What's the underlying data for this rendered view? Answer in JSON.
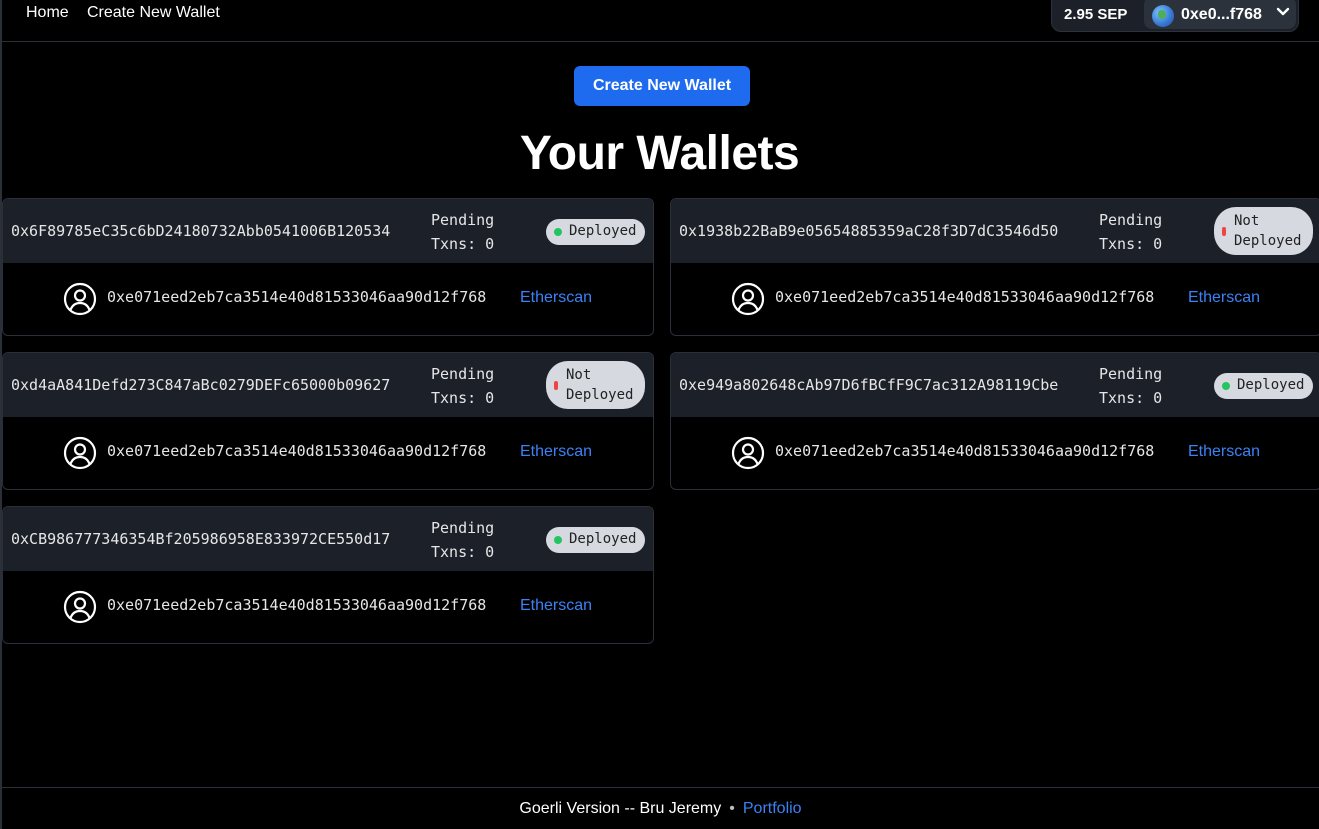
{
  "nav": {
    "home": "Home",
    "create": "Create New Wallet"
  },
  "account": {
    "balance": "2.95 SEP",
    "address_short": "0xe0...f768"
  },
  "main": {
    "create_button": "Create New Wallet",
    "title": "Your Wallets"
  },
  "wallets": [
    {
      "address": "0x6F89785eC35c6bD24180732Abb0541006B120534",
      "pending_label": "Pending",
      "txns": "Txns: 0",
      "status": "Deployed",
      "owner": "0xe071eed2eb7ca3514e40d81533046aa90d12f768",
      "link": "Etherscan"
    },
    {
      "address": "0x1938b22BaB9e05654885359aC28f3D7dC3546d50",
      "pending_label": "Pending",
      "txns": "Txns: 0",
      "status_line1": "Not",
      "status_line2": "Deployed",
      "owner": "0xe071eed2eb7ca3514e40d81533046aa90d12f768",
      "link": "Etherscan"
    },
    {
      "address": "0xd4aA841Defd273C847aBc0279DEFc65000b09627",
      "pending_label": "Pending",
      "txns": "Txns: 0",
      "status_line1": "Not",
      "status_line2": "Deployed",
      "owner": "0xe071eed2eb7ca3514e40d81533046aa90d12f768",
      "link": "Etherscan"
    },
    {
      "address": "0xe949a802648cAb97D6fBCfF9C7ac312A98119Cbe",
      "pending_label": "Pending",
      "txns": "Txns: 0",
      "status": "Deployed",
      "owner": "0xe071eed2eb7ca3514e40d81533046aa90d12f768",
      "link": "Etherscan"
    },
    {
      "address": "0xCB986777346354Bf205986958E833972CE550d17",
      "pending_label": "Pending",
      "txns": "Txns: 0",
      "status": "Deployed",
      "owner": "0xe071eed2eb7ca3514e40d81533046aa90d12f768",
      "link": "Etherscan"
    }
  ],
  "colors": {
    "primary": "#1e6bf0",
    "link": "#3b82f6",
    "deployed_dot": "#22c55e",
    "not_deployed_dot": "#ef4444",
    "card_header": "#1b2029"
  },
  "icons": {
    "network": "globe-icon",
    "menu": "chevron-down-icon",
    "owner": "user-circle-icon"
  },
  "footer": {
    "text": "Goerli Version -- Bru Jeremy",
    "separator": "•",
    "link": "Portfolio"
  }
}
